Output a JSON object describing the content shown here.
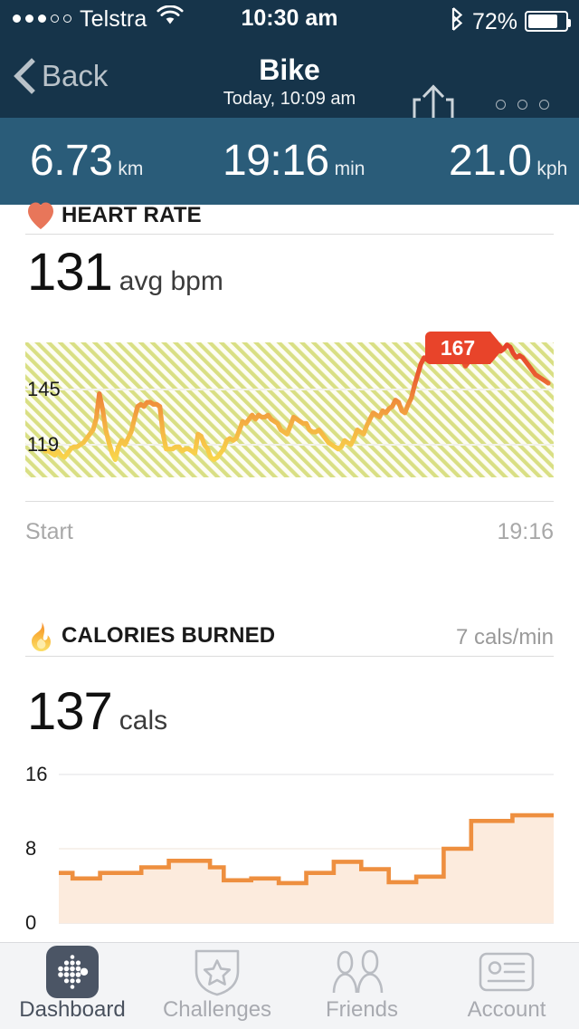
{
  "theme": {
    "navy_dark": "#16344a",
    "navy_mid": "#2a5c79",
    "accent_red": "#e8442a",
    "accent_orange": "#ef8c3c",
    "accent_yellow": "#f7d046",
    "heart_color": "#e8765a",
    "hatch_color": "#d7dd7e",
    "cal_fill": "#fcebdd",
    "tab_inactive": "#a8aab0",
    "tab_active": "#49515e"
  },
  "statusbar": {
    "signal_dots": [
      true,
      true,
      true,
      false,
      false
    ],
    "carrier": "Telstra",
    "wifi_icon": "wifi-icon",
    "time": "10:30 am",
    "bluetooth_icon": "bluetooth-icon",
    "battery_percent": "72%",
    "battery_level": 0.72
  },
  "navbar": {
    "back_label": "Back",
    "back_icon": "chevron-left-icon",
    "title": "Bike",
    "subtitle": "Today, 10:09 am",
    "share_icon": "share-icon",
    "more_icon": "more-options-icon"
  },
  "stats": [
    {
      "value": "6.73",
      "unit": "km"
    },
    {
      "value": "19:16",
      "unit": "min"
    },
    {
      "value": "21.0",
      "unit": "kph"
    }
  ],
  "heart_rate": {
    "icon": "heart-icon",
    "title": "HEART RATE",
    "value": "131",
    "label": "avg bpm",
    "tooltip_value": "167",
    "axis_start_label": "Start",
    "axis_end_label": "19:16"
  },
  "calories": {
    "icon": "flame-icon",
    "title": "CALORIES BURNED",
    "rate": "7 cals/min",
    "value": "137",
    "label": "cals"
  },
  "tabs": [
    {
      "label": "Dashboard",
      "icon": "fitbit-dots-icon",
      "active": true
    },
    {
      "label": "Challenges",
      "icon": "shield-star-icon",
      "active": false
    },
    {
      "label": "Friends",
      "icon": "two-people-icon",
      "active": false
    },
    {
      "label": "Account",
      "icon": "id-card-icon",
      "active": false
    }
  ],
  "chart_data": [
    {
      "type": "line",
      "title": "Heart Rate",
      "ylabel": "bpm",
      "xlabel": "",
      "grid": true,
      "ylim": [
        100,
        175
      ],
      "yticks": [
        119,
        145
      ],
      "ytick_labels": [
        "119",
        "145"
      ],
      "xtick_labels": [
        "Start",
        "19:16"
      ],
      "annotations": [
        {
          "text": "167",
          "value": 167
        }
      ],
      "series": [
        {
          "name": "bpm",
          "values": [
            116,
            116,
            115,
            114,
            116,
            114,
            113,
            115,
            117,
            118,
            118,
            119,
            120,
            122,
            124,
            126,
            131,
            143,
            136,
            126,
            120,
            115,
            112,
            118,
            121,
            119,
            122,
            125,
            131,
            137,
            138,
            137,
            139,
            139,
            138,
            138,
            137,
            124,
            117,
            117,
            117,
            118,
            118,
            116,
            117,
            117,
            116,
            115,
            124,
            123,
            119,
            117,
            113,
            112,
            113,
            115,
            117,
            121,
            122,
            121,
            122,
            126,
            130,
            129,
            131,
            133,
            131,
            133,
            132,
            132,
            133,
            131,
            130,
            129,
            126,
            125,
            124,
            128,
            132,
            131,
            130,
            129,
            129,
            126,
            125,
            125,
            126,
            124,
            122,
            120,
            119,
            118,
            117,
            118,
            121,
            120,
            119,
            122,
            126,
            125,
            124,
            128,
            131,
            134,
            133,
            132,
            135,
            134,
            136,
            137,
            140,
            139,
            135,
            134,
            138,
            141,
            147,
            152,
            157,
            160,
            159,
            158,
            159,
            160,
            161,
            160,
            159,
            160,
            162,
            163,
            162,
            159,
            156,
            158,
            161,
            162,
            161,
            161,
            162,
            163,
            166,
            167,
            165,
            163,
            164,
            166,
            165,
            162,
            160,
            161,
            160,
            158,
            156,
            154,
            152,
            151,
            150,
            149,
            148
          ]
        }
      ]
    },
    {
      "type": "area",
      "title": "Calories Burned",
      "ylabel": "cals/min",
      "xlabel": "",
      "grid": true,
      "ylim": [
        0,
        16
      ],
      "yticks": [
        0,
        8,
        16
      ],
      "ytick_labels": [
        "0",
        "8",
        "16"
      ],
      "step": true,
      "series": [
        {
          "name": "cals/min",
          "values": [
            5.4,
            4.8,
            4.8,
            5.4,
            5.4,
            5.4,
            6.0,
            6.0,
            6.7,
            6.7,
            6.7,
            6.0,
            4.6,
            4.6,
            4.8,
            4.8,
            4.3,
            4.3,
            5.4,
            5.4,
            6.6,
            6.6,
            5.8,
            5.8,
            4.4,
            4.4,
            5.0,
            5.0,
            8.0,
            8.0,
            11.0,
            11.0,
            11.0,
            11.6,
            11.6,
            11.6
          ]
        }
      ]
    }
  ]
}
